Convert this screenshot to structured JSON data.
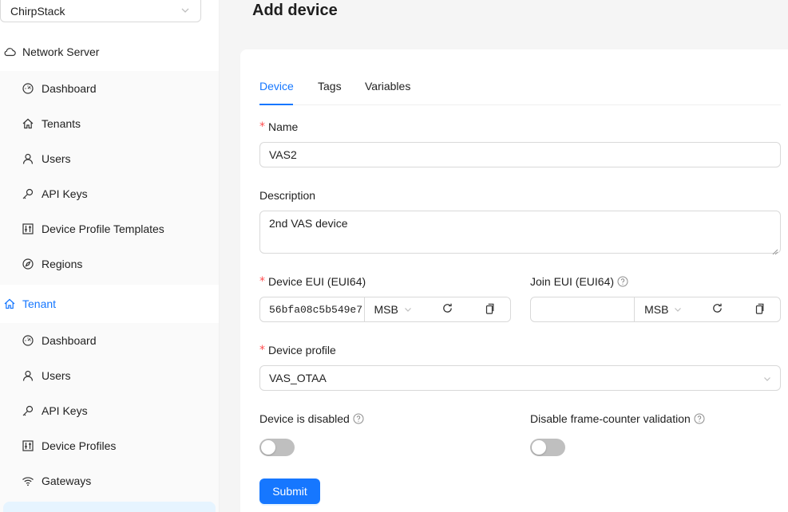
{
  "colors": {
    "primary": "#1677ff",
    "required": "#ff4d4f",
    "border": "#d9d9d9"
  },
  "sidebar": {
    "tenant_select": {
      "value": "ChirpStack",
      "icon": "chevron-down-icon"
    },
    "network_server": {
      "label": "Network Server",
      "icon": "cloud-icon",
      "items": [
        {
          "label": "Dashboard",
          "icon": "dashboard-icon"
        },
        {
          "label": "Tenants",
          "icon": "home-icon"
        },
        {
          "label": "Users",
          "icon": "user-icon"
        },
        {
          "label": "API Keys",
          "icon": "key-icon"
        },
        {
          "label": "Device Profile Templates",
          "icon": "sliders-icon"
        },
        {
          "label": "Regions",
          "icon": "compass-icon"
        }
      ]
    },
    "tenant": {
      "label": "Tenant",
      "icon": "home-icon",
      "items": [
        {
          "label": "Dashboard",
          "icon": "dashboard-icon"
        },
        {
          "label": "Users",
          "icon": "user-icon"
        },
        {
          "label": "API Keys",
          "icon": "key-icon"
        },
        {
          "label": "Device Profiles",
          "icon": "sliders-icon"
        },
        {
          "label": "Gateways",
          "icon": "wifi-icon"
        }
      ]
    }
  },
  "page": {
    "title": "Add device"
  },
  "tabs": [
    {
      "label": "Device",
      "active": true
    },
    {
      "label": "Tags",
      "active": false
    },
    {
      "label": "Variables",
      "active": false
    }
  ],
  "form": {
    "name": {
      "label": "Name",
      "required_mark": "*",
      "value": "VAS2"
    },
    "description": {
      "label": "Description",
      "value": "2nd VAS device"
    },
    "dev_eui": {
      "label": "Device EUI (EUI64)",
      "required_mark": "*",
      "value": "56bfa08c5b549e7",
      "byte_order": "MSB"
    },
    "join_eui": {
      "label": "Join EUI (EUI64)",
      "value": "",
      "byte_order": "MSB"
    },
    "device_profile": {
      "label": "Device profile",
      "required_mark": "*",
      "value": "VAS_OTAA"
    },
    "is_disabled": {
      "label": "Device is disabled",
      "checked": false
    },
    "skip_fcnt_check": {
      "label": "Disable frame-counter validation",
      "checked": false
    },
    "submit_label": "Submit"
  }
}
